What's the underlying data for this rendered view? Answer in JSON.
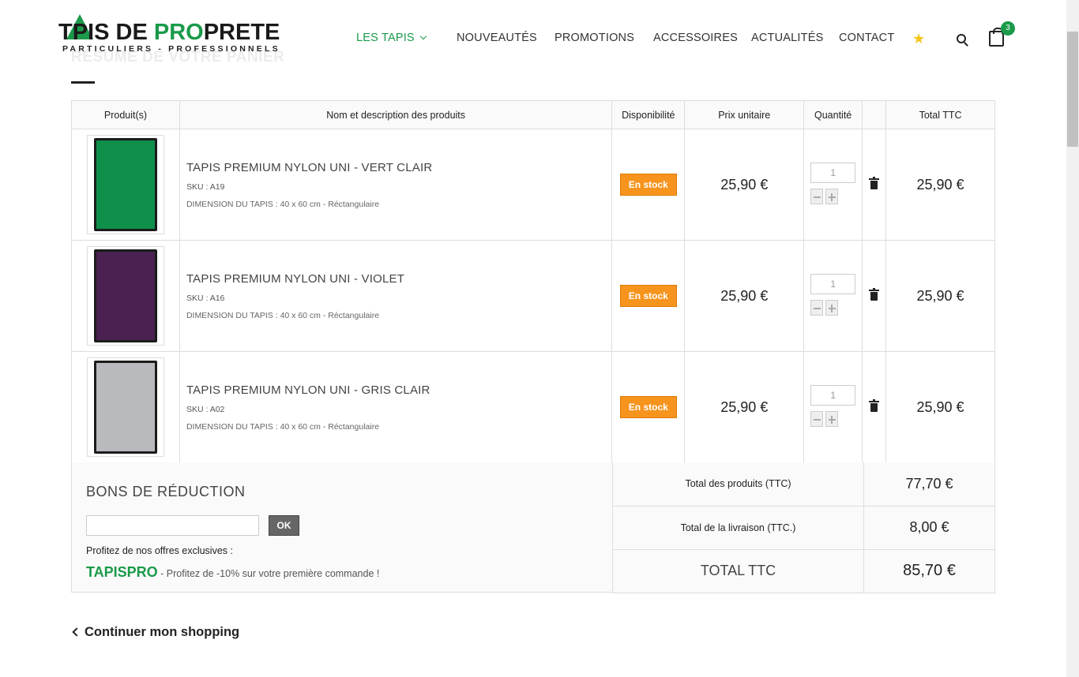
{
  "header": {
    "logo": {
      "part1": "T",
      "part2": "PIS DE ",
      "part3": "PRO",
      "part4": "PRETE",
      "sub": "PARTICULIERS - PROFESSIONNELS"
    },
    "nav": [
      {
        "label": "LES TAPIS"
      },
      {
        "label": "NOUVEAUTÉS"
      },
      {
        "label": "PROMOTIONS"
      },
      {
        "label": "ACCESSOIRES"
      },
      {
        "label": "ACTUALITÉS"
      },
      {
        "label": "CONTACT"
      }
    ],
    "cart_count": "3"
  },
  "page": {
    "title": "RÉSUMÉ DE VOTRE PANIER"
  },
  "table": {
    "headers": [
      "Produit(s)",
      "Nom et description des produits",
      "Disponibilité",
      "Prix unitaire",
      "Quantité",
      "",
      "Total TTC"
    ],
    "rows": [
      {
        "name": "TAPIS PREMIUM NYLON UNI - VERT CLAIR",
        "sku": "SKU : A19",
        "dimension": "DIMENSION DU TAPIS : 40 x 60 cm - Réctangulaire",
        "availability": "En stock",
        "unit_price": "25,90 €",
        "quantity": "1",
        "total": "25,90 €",
        "color": "#0f8f4a"
      },
      {
        "name": "TAPIS PREMIUM NYLON UNI - VIOLET",
        "sku": "SKU : A16",
        "dimension": "DIMENSION DU TAPIS : 40 x 60 cm - Réctangulaire",
        "availability": "En stock",
        "unit_price": "25,90 €",
        "quantity": "1",
        "total": "25,90 €",
        "color": "#4a2150"
      },
      {
        "name": "TAPIS PREMIUM NYLON UNI - GRIS CLAIR",
        "sku": "SKU : A02",
        "dimension": "DIMENSION DU TAPIS : 40 x 60 cm - Réctangulaire",
        "availability": "En stock",
        "unit_price": "25,90 €",
        "quantity": "1",
        "total": "25,90 €",
        "color": "#b9babd"
      }
    ]
  },
  "coupon": {
    "title": "BONS DE RÉDUCTION",
    "input_value": "",
    "button": "OK",
    "offers_label": "Profitez de nos offres exclusives :",
    "promo_code": "TAPISPRO",
    "promo_text": " - Profitez de -10% sur votre première commande !"
  },
  "totals": {
    "products_label": "Total des produits (TTC)",
    "products_value": "77,70 €",
    "shipping_label": "Total de la livraison (TTC.)",
    "shipping_value": "8,00 €",
    "total_label": "TOTAL TTC",
    "total_value": "85,70 €"
  },
  "continue_shopping": "Continuer mon shopping",
  "colors": {
    "brand_green": "#1a9a4a",
    "stock_orange": "#f7941d"
  }
}
